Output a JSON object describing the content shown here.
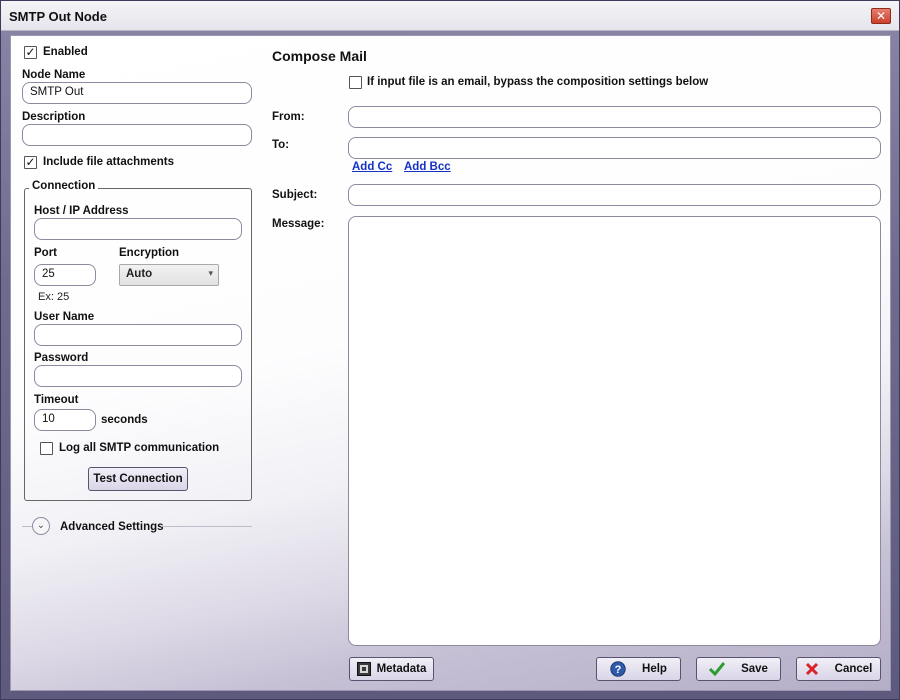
{
  "window": {
    "title": "SMTP Out Node",
    "close_glyph": "✕"
  },
  "left": {
    "enabled_label": "Enabled",
    "enabled_checked": true,
    "node_name_label": "Node Name",
    "node_name_value": "SMTP Out",
    "description_label": "Description",
    "description_value": "",
    "include_attachments_label": "Include file attachments",
    "include_attachments_checked": true,
    "connection": {
      "legend": "Connection",
      "host_label": "Host / IP Address",
      "host_value": "",
      "port_label": "Port",
      "port_value": "25",
      "port_hint": "Ex: 25",
      "encryption_label": "Encryption",
      "encryption_value": "Auto",
      "username_label": "User Name",
      "username_value": "",
      "password_label": "Password",
      "password_value": "",
      "timeout_label": "Timeout",
      "timeout_value": "10",
      "timeout_unit": "seconds",
      "log_label": "Log all SMTP communication",
      "log_checked": false,
      "test_button": "Test Connection"
    },
    "advanced_label": "Advanced Settings"
  },
  "compose": {
    "heading": "Compose Mail",
    "bypass_label": "If input file is an email, bypass the composition settings below",
    "bypass_checked": false,
    "from_label": "From:",
    "from_value": "",
    "to_label": "To:",
    "to_value": "",
    "add_cc": "Add Cc",
    "add_bcc": "Add Bcc",
    "subject_label": "Subject:",
    "subject_value": "",
    "message_label": "Message:",
    "message_value": ""
  },
  "footer": {
    "metadata": "Metadata",
    "help": "Help",
    "save": "Save",
    "cancel": "Cancel"
  },
  "colors": {
    "accent": "#1431c8",
    "save_check": "#2e9b2e",
    "cancel_x": "#d8242a",
    "help_icon": "#2f5aa8"
  }
}
